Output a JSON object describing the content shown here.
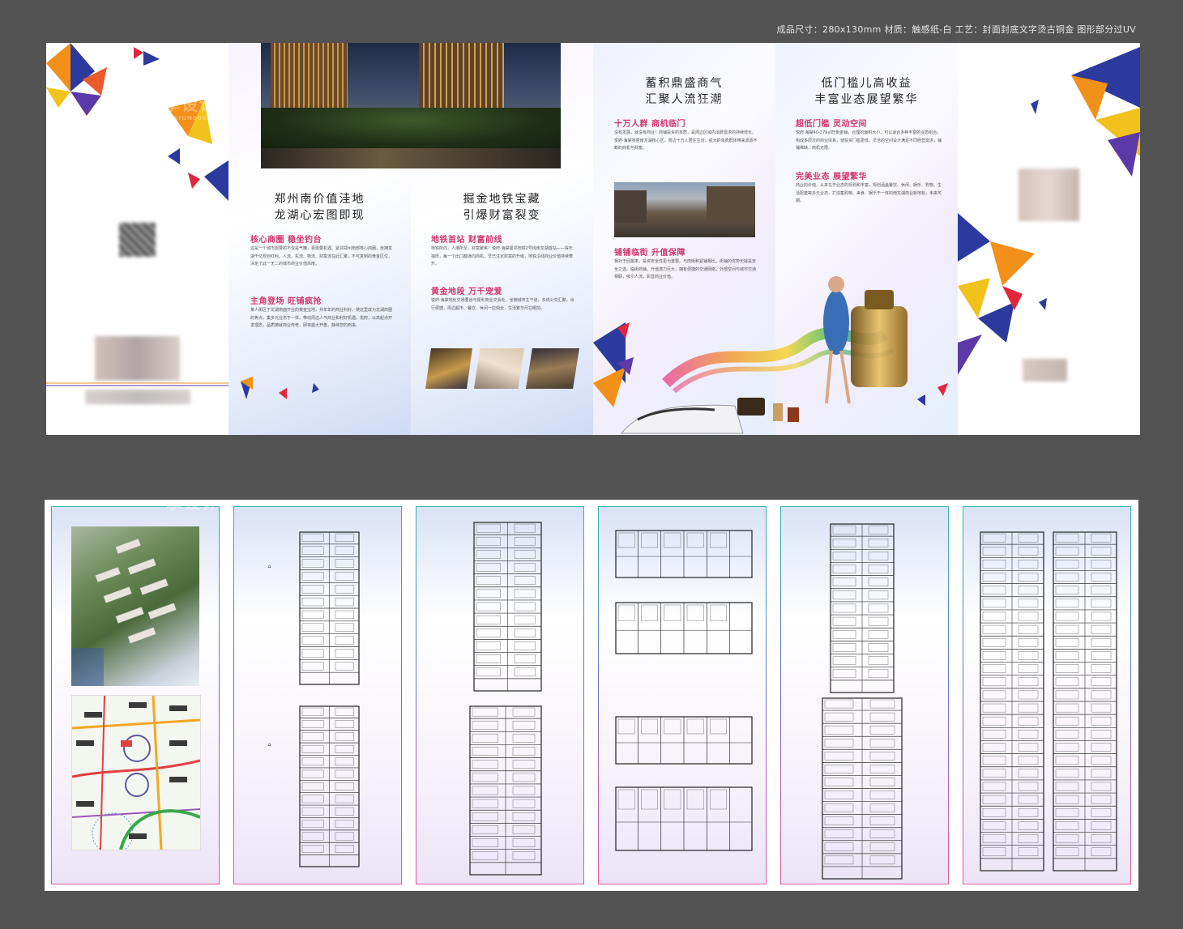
{
  "specs": "成品尺寸：280x130mm  材质：触感纸-白  工艺：封面封底文字烫古铜金  图形部分过UV",
  "watermark": {
    "brand": "享设计",
    "domain": "DESIGN006.COM"
  },
  "panel2": {
    "title_line1": "郑州南价值洼地",
    "title_line2": "龙湖心宏图即现",
    "sub1": "核心商圈  稳坐钓台",
    "text1": "这是一个城市需要的不仅是气魄，更需要机遇。紧邻郑州南部核心商圈，坐拥龙湖千亿规划红利，人流、车流、物流、财富流在此汇聚，不可复制的黄金区位，决定了此一无二的城市商业价值高度。",
    "sub2": "主角登场  旺铺疯抢",
    "text2": "某人街区于龙湖南面开业的黄金宝地，并年年的商业利好。使这里成为龙湖商圈的焦点，集多元业态于一体，带动周边人气商业和利好机遇。悦府，以高起点开发理念，品质铸就商业传奇，即将盛大开盘，静待您的到来。"
  },
  "panel3": {
    "title_line1": "掘金地铁宝藏",
    "title_line2": "引爆财富裂变",
    "sub1": "地铁首站  财富前线",
    "text1": "地铁所向，人潮所至，财富聚焦！悦府·海棠紧邻地铁2号线南龙湖首站——得天独厚，每一个出口都通向商机，早已注定财富的升级，地铁沿线商业价值持续攀升。",
    "sub2": "黄金地段  万千宠爱",
    "text2": "悦府·海棠地处交通要道与便利商业交会处，坐拥城市主干道，多线公交汇聚，出行便捷，周边超市、餐饮、休闲一应俱全，生活繁华尽在眼前。"
  },
  "panel4": {
    "title_line1": "蓄积鼎盛商气",
    "title_line2": "汇聚人流狂潮",
    "sub1": "十万人群  商机临门",
    "text1": "没有发展，就没有商业！商铺投资的本质，是周边区域内消费需求的持续增长。悦府·海棠身居南龙湖核心区，周边十万人居住生活，强大的消费群体带来源源不断的商机与财富。",
    "sub2": "铺铺临街  升值保障",
    "text2": "相对于回报率，投资安全性更为重要。与肉街和紧铺相比，街铺的优势无疑是安全之选。临街商铺，升值潜力巨大，拥有便捷的交通网络，外部空间与城市交通相联，吸引人流，彰显商业价值。"
  },
  "panel5": {
    "title_line1": "低门槛儿高收益",
    "title_line2": "丰富业态展望繁华",
    "sub1": "超低门槛  灵动空间",
    "text1": "悦府·海棠40-279㎡旺街金铺，合理的面积大小，可以适合多种丰富的业态组合，构成多层次的商业体系，使投资门槛更低，灵活的空间设计满足不同经营需求，铺铺稀缺，商机无限。",
    "sub2": "完美业态  展望繁华",
    "text2": "商业的价值，从来在于业态的规划和丰富，规划涵盖餐饮、休闲、娱乐、购物、生活配套等多元业态，打造集购物、美食、娱乐于一体的南龙湖商业新地标，未来可期。"
  },
  "colors": {
    "accent_pink": "#d2386d",
    "blue": "#2c3a9e",
    "orange": "#f39019",
    "red": "#e3263c"
  }
}
